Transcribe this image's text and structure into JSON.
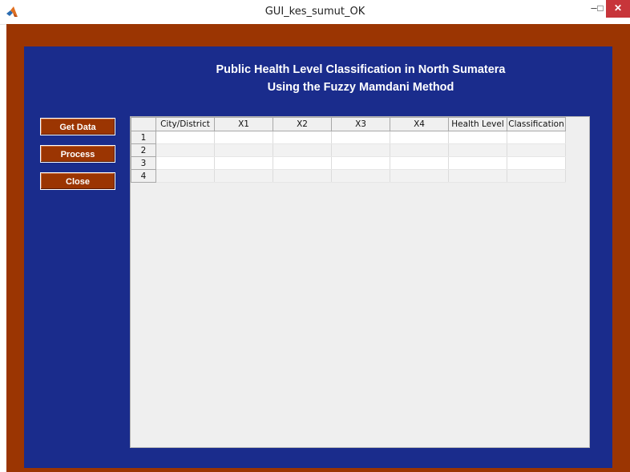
{
  "window": {
    "title": "GUI_kes_sumut_OK",
    "icon": "matlab-icon",
    "controls": {
      "minimize": "–",
      "maximize": "□",
      "close": "✕"
    }
  },
  "heading": {
    "line1": "Public Health Level Classification in North Sumatera",
    "line2": "Using the Fuzzy Mamdani Method"
  },
  "buttons": {
    "get_data": "Get Data",
    "process": "Process",
    "close": "Close"
  },
  "table": {
    "columns": [
      "City/District",
      "X1",
      "X2",
      "X3",
      "X4",
      "Health Level",
      "Classification"
    ],
    "rows": [
      "1",
      "2",
      "3",
      "4"
    ]
  },
  "colors": {
    "frame": "#9b3502",
    "panel": "#1a2c8c",
    "button": "#9b3502",
    "close_button": "#c7353a"
  }
}
